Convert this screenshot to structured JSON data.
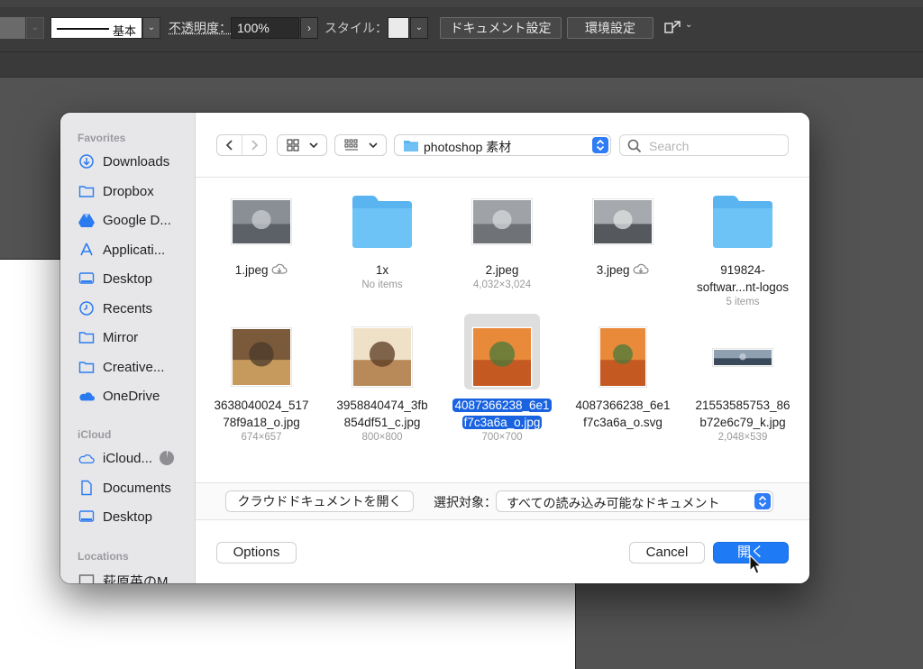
{
  "app_toolbar": {
    "stroke_label": "基本",
    "opacity_label": "不透明度：",
    "opacity_value": "100%",
    "style_label": "スタイル：",
    "document_settings": "ドキュメント設定",
    "preferences": "環境設定"
  },
  "dialog": {
    "sidebar": {
      "favorites_header": "Favorites",
      "favorites": [
        {
          "label": "Downloads",
          "icon": "download-icon"
        },
        {
          "label": "Dropbox",
          "icon": "folder-icon"
        },
        {
          "label": "Google D...",
          "icon": "google-drive-icon"
        },
        {
          "label": "Applicati...",
          "icon": "applications-icon"
        },
        {
          "label": "Desktop",
          "icon": "desktop-icon"
        },
        {
          "label": "Recents",
          "icon": "clock-icon"
        },
        {
          "label": "Mirror",
          "icon": "folder-icon"
        },
        {
          "label": "Creative...",
          "icon": "folder-icon"
        },
        {
          "label": "OneDrive",
          "icon": "onedrive-icon"
        }
      ],
      "icloud_header": "iCloud",
      "icloud": [
        {
          "label": "iCloud...",
          "icon": "cloud-icon"
        },
        {
          "label": "Documents",
          "icon": "document-icon"
        },
        {
          "label": "Desktop",
          "icon": "desktop-icon"
        }
      ],
      "locations_header": "Locations",
      "locations": [
        {
          "label": "萩原英のM...",
          "icon": "computer-icon"
        }
      ]
    },
    "toolbar": {
      "current_folder": "photoshop 素材",
      "search_placeholder": "Search"
    },
    "files": [
      {
        "name1": "1.jpeg",
        "name2": "",
        "sub": "",
        "kind": "photo",
        "cloud": true
      },
      {
        "name1": "1x",
        "name2": "",
        "sub": "No items",
        "kind": "folder",
        "cloud": false
      },
      {
        "name1": "2.jpeg",
        "name2": "",
        "sub": "4,032×3,024",
        "kind": "photo",
        "cloud": false
      },
      {
        "name1": "3.jpeg",
        "name2": "",
        "sub": "",
        "kind": "photo",
        "cloud": true
      },
      {
        "name1": "919824-",
        "name2": "softwar...nt-logos",
        "sub": "5 items",
        "kind": "folder",
        "cloud": false
      },
      {
        "name1": "3638040024_517",
        "name2": "78f9a18_o.jpg",
        "sub": "674×657",
        "kind": "photo",
        "cloud": false
      },
      {
        "name1": "3958840474_3fb",
        "name2": "854df51_c.jpg",
        "sub": "800×800",
        "kind": "photo",
        "cloud": false
      },
      {
        "name1": "4087366238_6e1",
        "name2": "f7c3a6a_o.jpg",
        "sub": "700×700",
        "kind": "photo",
        "cloud": false,
        "selected": true
      },
      {
        "name1": "4087366238_6e1",
        "name2": "f7c3a6a_o.svg",
        "sub": "",
        "kind": "photo",
        "cloud": false
      },
      {
        "name1": "21553585753_86",
        "name2": "b72e6c79_k.jpg",
        "sub": "2,048×539",
        "kind": "photo",
        "cloud": false
      }
    ],
    "filter": {
      "cloud_button": "クラウドドキュメントを開く",
      "label": "選択対象：",
      "value": "すべての読み込み可能なドキュメント"
    },
    "buttons": {
      "options": "Options",
      "cancel": "Cancel",
      "open": "開く"
    },
    "colors": {
      "accent": "#1e7af5",
      "folder": "#5ab4f0",
      "selection": "#1a63e0"
    }
  }
}
